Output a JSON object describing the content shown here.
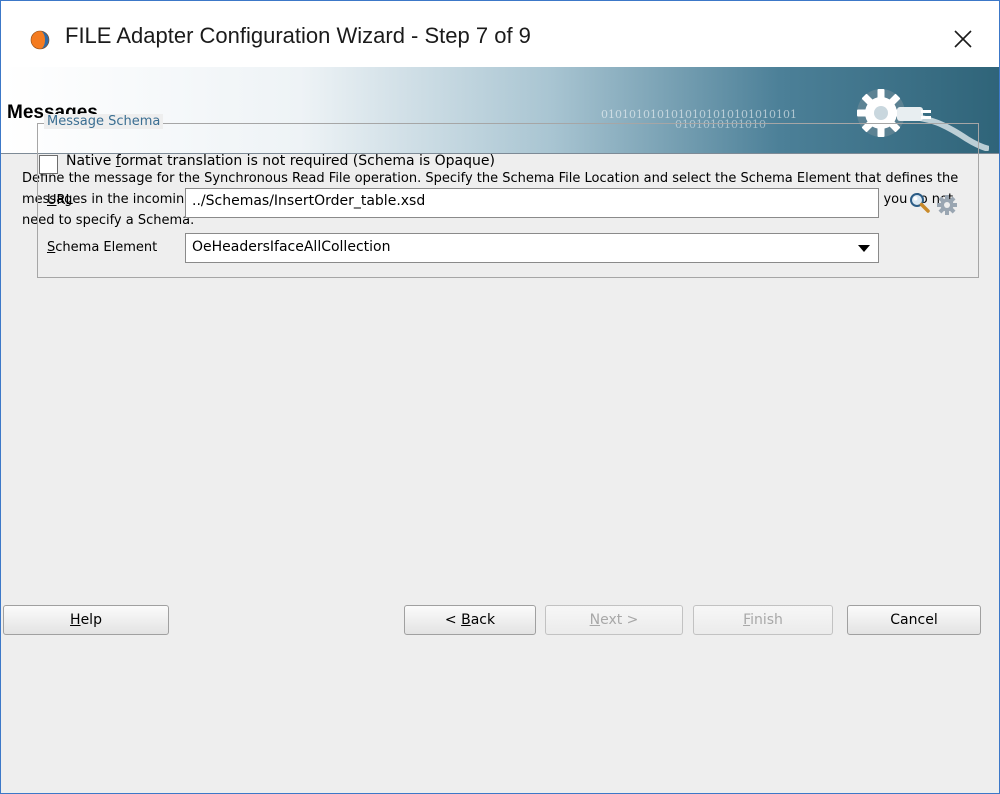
{
  "window": {
    "title": "FILE Adapter Configuration Wizard - Step 7 of 9"
  },
  "banner": {
    "title": "Messages",
    "binary_line1": "0101010101010101010101010101",
    "binary_line2": "0101010101010"
  },
  "description": "Define the message for the Synchronous Read File operation.  Specify the Schema File Location and select the Schema Element that defines the messages in the incoming files. Use the Browse button to find an existing schema definition. If you check 'Schema is Opaque', then you do not need to specify a Schema.",
  "message_schema": {
    "legend": "Message Schema",
    "opaque_checkbox": {
      "label_pre": "Native ",
      "label_mnemonic": "f",
      "label_post": "ormat translation is not required (Schema is Opaque)",
      "checked": false
    },
    "url": {
      "label_mnemonic": "U",
      "label_rest": "RL",
      "value": "../Schemas/InsertOrder_table.xsd"
    },
    "schema_element": {
      "label_mnemonic": "S",
      "label_rest": "chema Element",
      "selected": "OeHeadersIfaceAllCollection"
    }
  },
  "buttons": {
    "help": {
      "mnemonic": "H",
      "rest": "elp"
    },
    "back": {
      "pre": "< ",
      "mnemonic": "B",
      "rest": "ack"
    },
    "next": {
      "mnemonic": "N",
      "rest": "ext >"
    },
    "finish": {
      "mnemonic": "F",
      "rest": "inish"
    },
    "cancel": {
      "label": "Cancel"
    }
  },
  "colors": {
    "accent": "#3a6e92",
    "banner_dark": "#2f6479",
    "window_border": "#3c78c8"
  }
}
